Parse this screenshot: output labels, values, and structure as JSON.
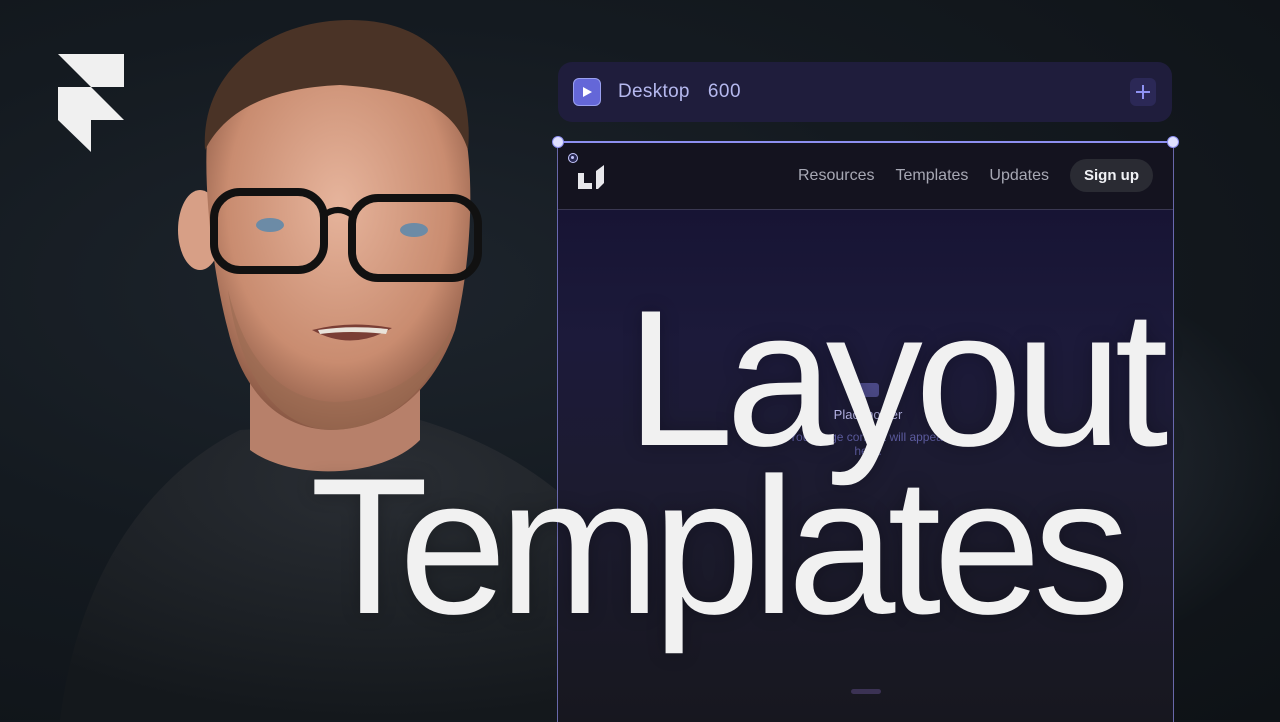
{
  "brand": {
    "logo_icon": "framer-logo-icon"
  },
  "toolbar": {
    "play_icon": "play-icon",
    "breakpoint_label": "Desktop",
    "breakpoint_width": "600",
    "add_icon": "plus-icon",
    "accent": "#6467d8"
  },
  "site_preview": {
    "logo_icon": "site-logo-icon",
    "nav": [
      "Resources",
      "Templates",
      "Updates"
    ],
    "cta": "Sign up",
    "placeholder": {
      "icon": "placeholder-icon",
      "title": "Placeholder",
      "description": "Your page content will appear here."
    }
  },
  "headline": {
    "line1": "Layout",
    "line2": "Templates"
  },
  "colors": {
    "background": "#141a20",
    "frame_border": "#8d8ff0",
    "headline": "#f1f1f1"
  }
}
